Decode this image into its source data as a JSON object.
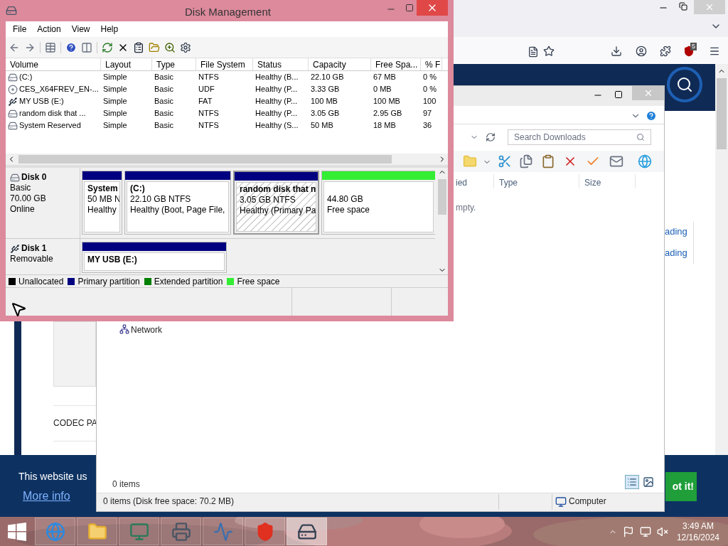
{
  "disk_management": {
    "title": "Disk Management",
    "menu": [
      "File",
      "Action",
      "View",
      "Help"
    ],
    "columns": [
      "Volume",
      "Layout",
      "Type",
      "File System",
      "Status",
      "Capacity",
      "Free Spa...",
      "% F"
    ],
    "rows": [
      {
        "kind": "hdd",
        "cells": [
          "(C:)",
          "Simple",
          "Basic",
          "NTFS",
          "Healthy (B...",
          "22.10 GB",
          "67 MB",
          "0 %"
        ]
      },
      {
        "kind": "disc",
        "cells": [
          "CES_X64FREV_EN-...",
          "Simple",
          "Basic",
          "UDF",
          "Healthy (P...",
          "3.33 GB",
          "0 MB",
          "0 %"
        ]
      },
      {
        "kind": "usb",
        "cells": [
          "MY USB (E:)",
          "Simple",
          "Basic",
          "FAT",
          "Healthy (P...",
          "100 MB",
          "100 MB",
          "100"
        ]
      },
      {
        "kind": "hdd",
        "cells": [
          "random disk that ...",
          "Simple",
          "Basic",
          "NTFS",
          "Healthy (P...",
          "3.05 GB",
          "2.95 GB",
          "97"
        ]
      },
      {
        "kind": "hdd",
        "cells": [
          "System Reserved",
          "Simple",
          "Basic",
          "NTFS",
          "Healthy (S...",
          "50 MB",
          "18 MB",
          "36"
        ]
      }
    ],
    "disks": [
      {
        "kind": "hdd",
        "name": "Disk 0",
        "lines": [
          "Basic",
          "70.00 GB",
          "Online"
        ],
        "partitions": [
          {
            "kind": "primary",
            "name": "System",
            "lines": [
              "50 MB N",
              "Healthy"
            ],
            "selected": false
          },
          {
            "kind": "primary",
            "name": "(C:)",
            "lines": [
              "22.10 GB NTFS",
              "Healthy (Boot, Page File,"
            ],
            "selected": false
          },
          {
            "kind": "primary",
            "name": "random disk that n",
            "lines": [
              "3.05 GB NTFS",
              "Healthy (Primary Pa"
            ],
            "selected": true
          },
          {
            "kind": "free",
            "lines": [
              "44.80 GB",
              "Free space"
            ],
            "selected": false
          }
        ]
      },
      {
        "kind": "usb",
        "name": "Disk 1",
        "lines": [
          "Removable"
        ],
        "partitions": [
          {
            "kind": "primary",
            "name": "MY USB  (E:)",
            "selected": false
          }
        ]
      }
    ],
    "legend": [
      {
        "label": "Unallocated",
        "color": "#000000"
      },
      {
        "label": "Primary partition",
        "color": "#000080"
      },
      {
        "label": "Extended partition",
        "color": "#008000"
      },
      {
        "label": "Free space",
        "color": "#33ee33"
      }
    ]
  },
  "browser": {
    "badge": "5",
    "side_item": "CODEC PA",
    "right_items": [
      "ading",
      "ading"
    ],
    "cookie": {
      "text": "This website us",
      "link": "More info",
      "button": "ot it!"
    }
  },
  "explorer": {
    "search_placeholder": "Search Downloads",
    "columns": [
      "ied",
      "Type",
      "Size"
    ],
    "empty_text": "mpty.",
    "nav_item": "Network",
    "item_count": "0 items",
    "status_text": "0 items (Disk free space: 70.2 MB)",
    "location": "Computer"
  },
  "taskbar": {
    "time": "3:49 AM",
    "date": "12/16/2024"
  }
}
